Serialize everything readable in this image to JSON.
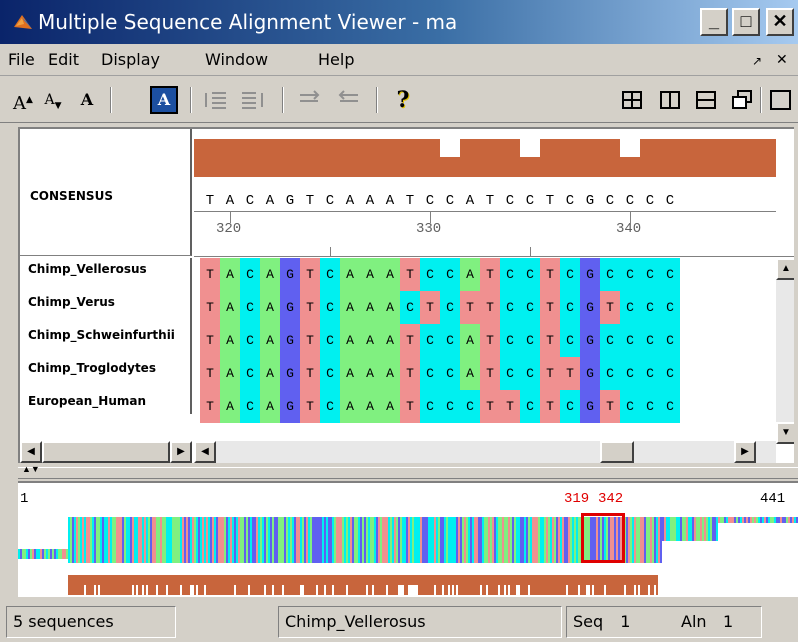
{
  "window": {
    "title": "Multiple Sequence Alignment Viewer - ma"
  },
  "menubar": {
    "items": [
      "File",
      "Edit",
      "Display",
      "Window",
      "Help"
    ]
  },
  "toolbar": {
    "font_increase": "A",
    "font_decrease": "A",
    "font_normal": "A",
    "highlight": "A",
    "help": "?"
  },
  "alignment": {
    "consensus_label": "CONSENSUS",
    "consensus": [
      "T",
      "A",
      "C",
      "A",
      "G",
      "T",
      "C",
      "A",
      "A",
      "A",
      "T",
      "C",
      "C",
      "A",
      "T",
      "C",
      "C",
      "T",
      "C",
      "G",
      "C",
      "C",
      "C",
      "C"
    ],
    "consensus_bar_dips": [
      12,
      16,
      21
    ],
    "ruler_labels": [
      {
        "pos": 320,
        "col": 1
      },
      {
        "pos": 330,
        "col": 11
      },
      {
        "pos": 340,
        "col": 21
      }
    ],
    "ruler_label_text": [
      "320",
      "330",
      "340"
    ],
    "sequences": [
      {
        "name": "Chimp_Vellerosus",
        "residues": "TACAGTCAAATCCATCCTCGCCCC"
      },
      {
        "name": "Chimp_Verus",
        "residues": "TACAGTCAAACTCTTCCTCGTCCC"
      },
      {
        "name": "Chimp_Schweinfurthii",
        "residues": "TACAGTCAAATCCATCCTCGCCCC"
      },
      {
        "name": "Chimp_Troglodytes",
        "residues": "TACAGTCAAATCCATCCTTGCCCC"
      },
      {
        "name": "European_Human",
        "residues": "TACAGTCAAATCCCTTCTCGTCCC"
      }
    ],
    "colors": {
      "A": "#80f080",
      "C": "#00f0f0",
      "G": "#6060f0",
      "T": "#f09090"
    }
  },
  "overview": {
    "start": "1",
    "window_start": "319",
    "window_end": "342",
    "end": "441",
    "highlight_color": "#ff0000"
  },
  "status": {
    "count": "5 sequences",
    "selected": "Chimp_Vellerosus",
    "seq_label": "Seq",
    "seq_value": "1",
    "aln_label": "Aln",
    "aln_value": "1"
  }
}
